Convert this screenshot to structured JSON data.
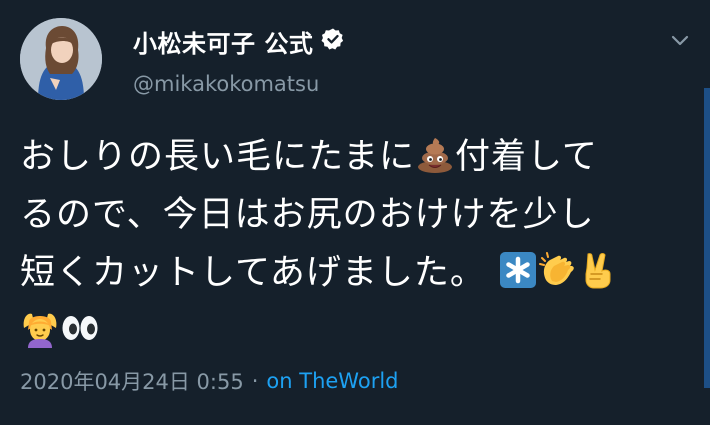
{
  "author": {
    "display_name": "小松未可子 公式",
    "handle": "@mikakokomatsu",
    "verified": true
  },
  "tweet": {
    "line1a": "おしりの長い毛にたまに",
    "line1b": "付着して",
    "line2": "るので、今日はお尻のおけけを少し",
    "line3": "短くカットしてあげました。",
    "emojis": [
      "pile-of-poo",
      "asterisk-key",
      "clapping-hands",
      "victory-hand",
      "person-gesturing-ok",
      "eyes"
    ]
  },
  "meta": {
    "timestamp": "2020年04月24日 0:55",
    "separator": "·",
    "client": "on TheWorld"
  },
  "colors": {
    "background": "#15202b",
    "secondary_text": "#8899a6",
    "link": "#1da1f2",
    "verified_badge": "#ffffff"
  }
}
